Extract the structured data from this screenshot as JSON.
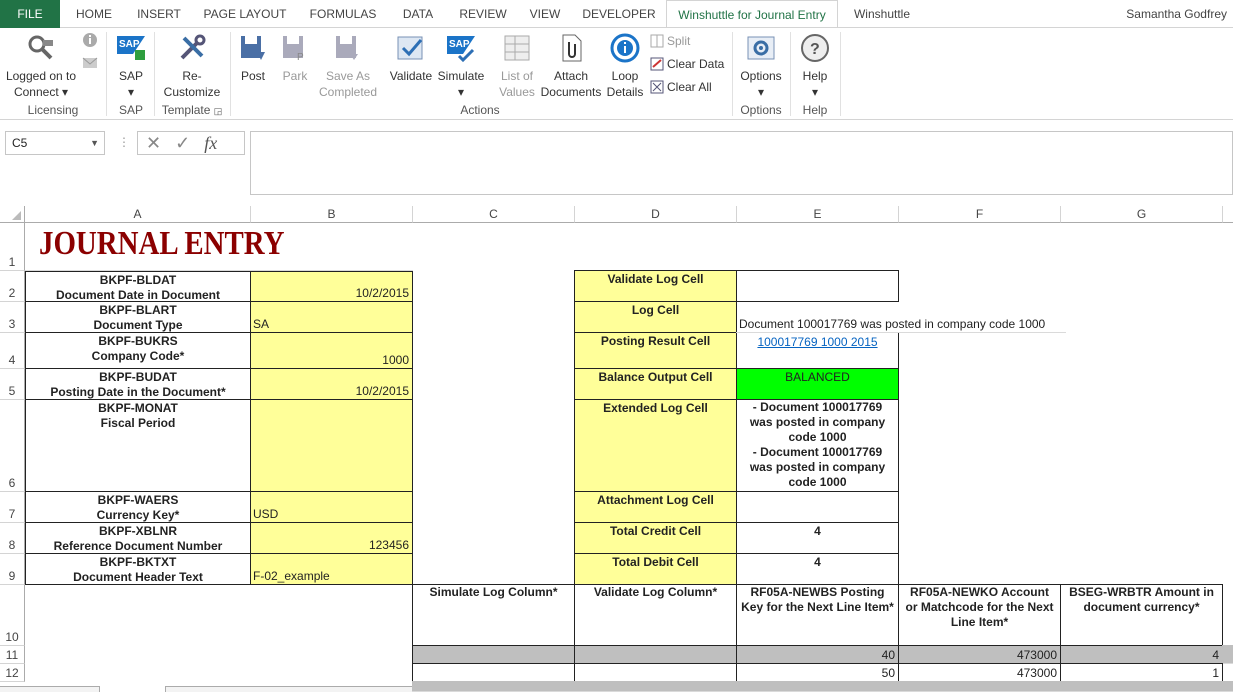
{
  "tabs": [
    "FILE",
    "HOME",
    "INSERT",
    "PAGE LAYOUT",
    "FORMULAS",
    "DATA",
    "REVIEW",
    "VIEW",
    "DEVELOPER",
    "Winshuttle for Journal Entry",
    "Winshuttle"
  ],
  "user": "Samantha Godfrey",
  "ribbon": {
    "logged_on": "Logged on to",
    "connect": "Connect",
    "sap": "SAP",
    "recustomize_1": "Re-",
    "recustomize_2": "Customize",
    "post": "Post",
    "park": "Park",
    "save_as_1": "Save As",
    "save_as_2": "Completed",
    "validate": "Validate",
    "simulate": "Simulate",
    "list_1": "List of",
    "list_2": "Values",
    "attach_1": "Attach",
    "attach_2": "Documents",
    "loop_1": "Loop",
    "loop_2": "Details",
    "split": "Split",
    "clear_data": "Clear Data",
    "clear_all": "Clear All",
    "options": "Options",
    "help": "Help",
    "groups": {
      "licensing": "Licensing",
      "sap": "SAP",
      "template": "Template",
      "actions": "Actions",
      "options": "Options",
      "help": "Help"
    }
  },
  "formula_bar": {
    "name_box": "C5",
    "formula": ""
  },
  "columns": [
    "A",
    "B",
    "C",
    "D",
    "E",
    "F",
    "G"
  ],
  "rows": [
    "1",
    "2",
    "3",
    "4",
    "5",
    "6",
    "7",
    "8",
    "9",
    "10",
    "11",
    "12"
  ],
  "sheet": {
    "title": "JOURNAL ENTRY",
    "fields": [
      {
        "code": "BKPF-BLDAT",
        "desc": "Document Date in Document",
        "value": "10/2/2015",
        "align": "right"
      },
      {
        "code": "BKPF-BLART",
        "desc": "Document Type",
        "value": "SA",
        "align": "left"
      },
      {
        "code": "BKPF-BUKRS",
        "desc": "Company Code*",
        "value": "1000",
        "align": "right"
      },
      {
        "code": "BKPF-BUDAT",
        "desc": "Posting Date in the Document*",
        "value": "10/2/2015",
        "align": "right"
      },
      {
        "code": "BKPF-MONAT",
        "desc": "Fiscal Period",
        "value": "",
        "align": "right"
      },
      {
        "code": "BKPF-WAERS",
        "desc": "Currency Key*",
        "value": "USD",
        "align": "left"
      },
      {
        "code": "BKPF-XBLNR",
        "desc": "Reference Document Number",
        "value": "123456",
        "align": "right"
      },
      {
        "code": "BKPF-BKTXT",
        "desc": "Document Header Text",
        "value": "F-02_example",
        "align": "left"
      }
    ],
    "log_labels": [
      "Validate Log Cell",
      "Log Cell",
      "Posting Result Cell",
      "Balance Output Cell",
      "Extended Log Cell",
      "Attachment Log Cell",
      "Total Credit Cell",
      "Total Debit Cell"
    ],
    "log_values": {
      "log_cell": "Document 100017769 was posted in company code 1000",
      "posting_result": "100017769 1000 2015",
      "balance": "BALANCED",
      "extended_1": "- Document 100017769 was posted in company code 1000",
      "extended_2": "- Document 100017769 was posted in company code 1000",
      "total_credit": "4",
      "total_debit": "4"
    },
    "line_headers": {
      "c": "Simulate Log Column*",
      "d": "Validate Log Column*",
      "e": "RF05A-NEWBS Posting Key for the Next Line Item*",
      "f": "RF05A-NEWKO Account or Matchcode for the Next Line Item*",
      "g": "BSEG-WRBTR Amount in document currency*"
    },
    "lines": [
      {
        "e": "40",
        "f": "473000",
        "g": "4"
      },
      {
        "e": "50",
        "f": "473000",
        "g": "1"
      }
    ]
  },
  "colors": {
    "excel_green": "#217346",
    "yellow": "#ffff99",
    "balanced": "#00ff00",
    "title_red": "#8b0000",
    "link": "#0563c1"
  }
}
